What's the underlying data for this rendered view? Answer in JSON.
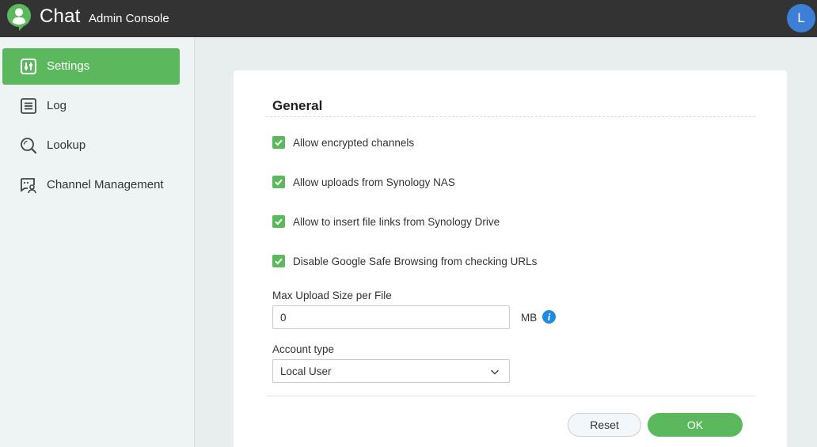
{
  "header": {
    "app_title": "Chat",
    "app_subtitle": "Admin Console",
    "avatar_initial": "L",
    "avatar_color": "#3d7fd6"
  },
  "sidebar": {
    "items": [
      {
        "label": "Settings",
        "icon": "settings-sliders-icon",
        "active": true
      },
      {
        "label": "Log",
        "icon": "log-list-icon",
        "active": false
      },
      {
        "label": "Lookup",
        "icon": "lookup-magnifier-icon",
        "active": false
      },
      {
        "label": "Channel Management",
        "icon": "channel-management-icon",
        "active": false
      }
    ]
  },
  "general": {
    "title": "General",
    "options": [
      {
        "label": "Allow encrypted channels",
        "checked": true
      },
      {
        "label": "Allow uploads from Synology NAS",
        "checked": true
      },
      {
        "label": "Allow to insert file links from Synology Drive",
        "checked": true
      },
      {
        "label": "Disable Google Safe Browsing from checking URLs",
        "checked": true
      }
    ],
    "max_upload": {
      "label": "Max Upload Size per File",
      "value": "0",
      "unit": "MB",
      "info_glyph": "i"
    },
    "account_type": {
      "label": "Account type",
      "value": "Local User"
    }
  },
  "actions": {
    "reset_label": "Reset",
    "ok_label": "OK"
  },
  "colors": {
    "accent": "#5cb85c",
    "header_bg": "#333333",
    "info": "#1e8ae6"
  }
}
